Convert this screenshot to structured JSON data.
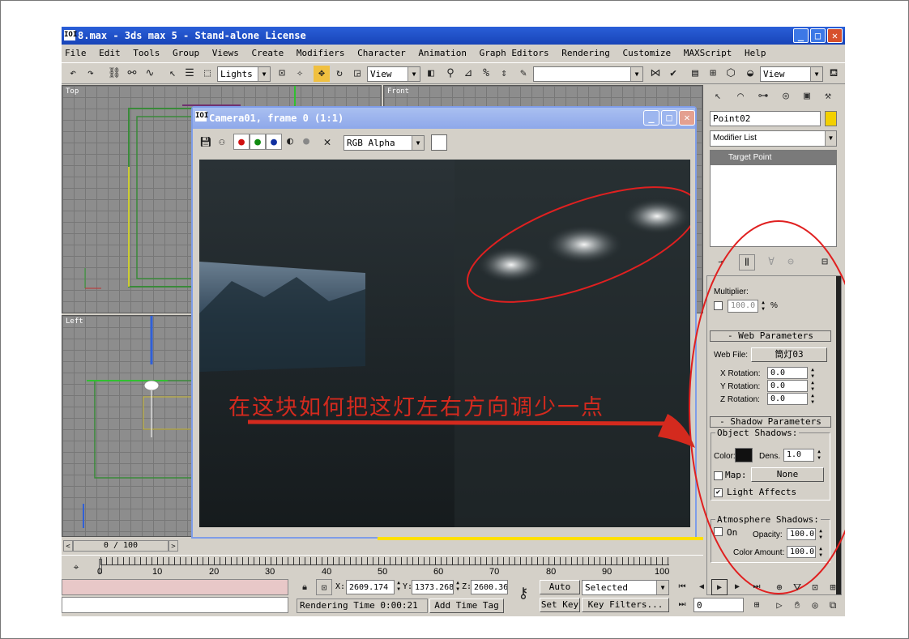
{
  "window": {
    "title": "8.max - 3ds max 5 - Stand-alone License",
    "icon_text": "IOI"
  },
  "menu": [
    "File",
    "Edit",
    "Tools",
    "Group",
    "Views",
    "Create",
    "Modifiers",
    "Character",
    "Animation",
    "Graph Editors",
    "Rendering",
    "Customize",
    "MAXScript",
    "Help"
  ],
  "toolbar": {
    "selection_filter": "Lights",
    "coord_system": "View",
    "named_selection": "",
    "view_dropdown": "View"
  },
  "viewports": {
    "top_label": "Top",
    "front_label": "Front",
    "left_label": "Left"
  },
  "frame_window": {
    "title": "Camera01, frame 0 (1:1)",
    "icon_text": "IOI",
    "channel_dropdown": "RGB Alpha",
    "annotation": "在这块如何把这灯左右方向调少一点"
  },
  "command_panel": {
    "object_name": "Point02",
    "object_color": "#f2d000",
    "modifier_list": "Modifier List",
    "stack_item": "Target Point",
    "multiplier_label": "Multiplier:",
    "multiplier_value": "100.0",
    "multiplier_unit": "%",
    "web_params_header": "- Web Parameters",
    "web_file_label": "Web File:",
    "web_file_value": "筒灯03",
    "x_rotation_label": "X Rotation:",
    "x_rotation": "0.0",
    "y_rotation_label": "Y Rotation:",
    "y_rotation": "0.0",
    "z_rotation_label": "Z Rotation:",
    "z_rotation": "0.0",
    "shadow_params_header": "- Shadow Parameters",
    "object_shadows_label": "Object Shadows:",
    "color_label": "Color:",
    "shadow_color": "#111111",
    "dens_label": "Dens.",
    "dens_value": "1.0",
    "map_label": "Map:",
    "map_value": "None",
    "light_affects_label": "Light Affects",
    "atmosphere_shadows_label": "Atmosphere Shadows:",
    "on_label": "On",
    "opacity_label": "Opacity:",
    "opacity_value": "100.0",
    "color_amount_label": "Color Amount:",
    "color_amount_value": "100.0"
  },
  "timeline": {
    "frame_display": "0 / 100",
    "ticks": [
      "0",
      "10",
      "20",
      "30",
      "40",
      "50",
      "60",
      "70",
      "80",
      "90",
      "100"
    ]
  },
  "status": {
    "x_label": "X:",
    "x_value": "2609.174",
    "y_label": "Y:",
    "y_value": "1373.268",
    "z_label": "Z:",
    "z_value": "2600.36",
    "rendering_time": "Rendering Time  0:00:21",
    "add_time_tag": "Add Time Tag",
    "auto_key": "Auto Key",
    "set_key": "Set Key",
    "selected": "Selected",
    "key_filters": "Key Filters...",
    "frame_field": "0"
  },
  "colors": {
    "title_blue": "#1f4fcf",
    "annotation_red": "#d42a1e",
    "ui_gray": "#d4d0c8"
  }
}
